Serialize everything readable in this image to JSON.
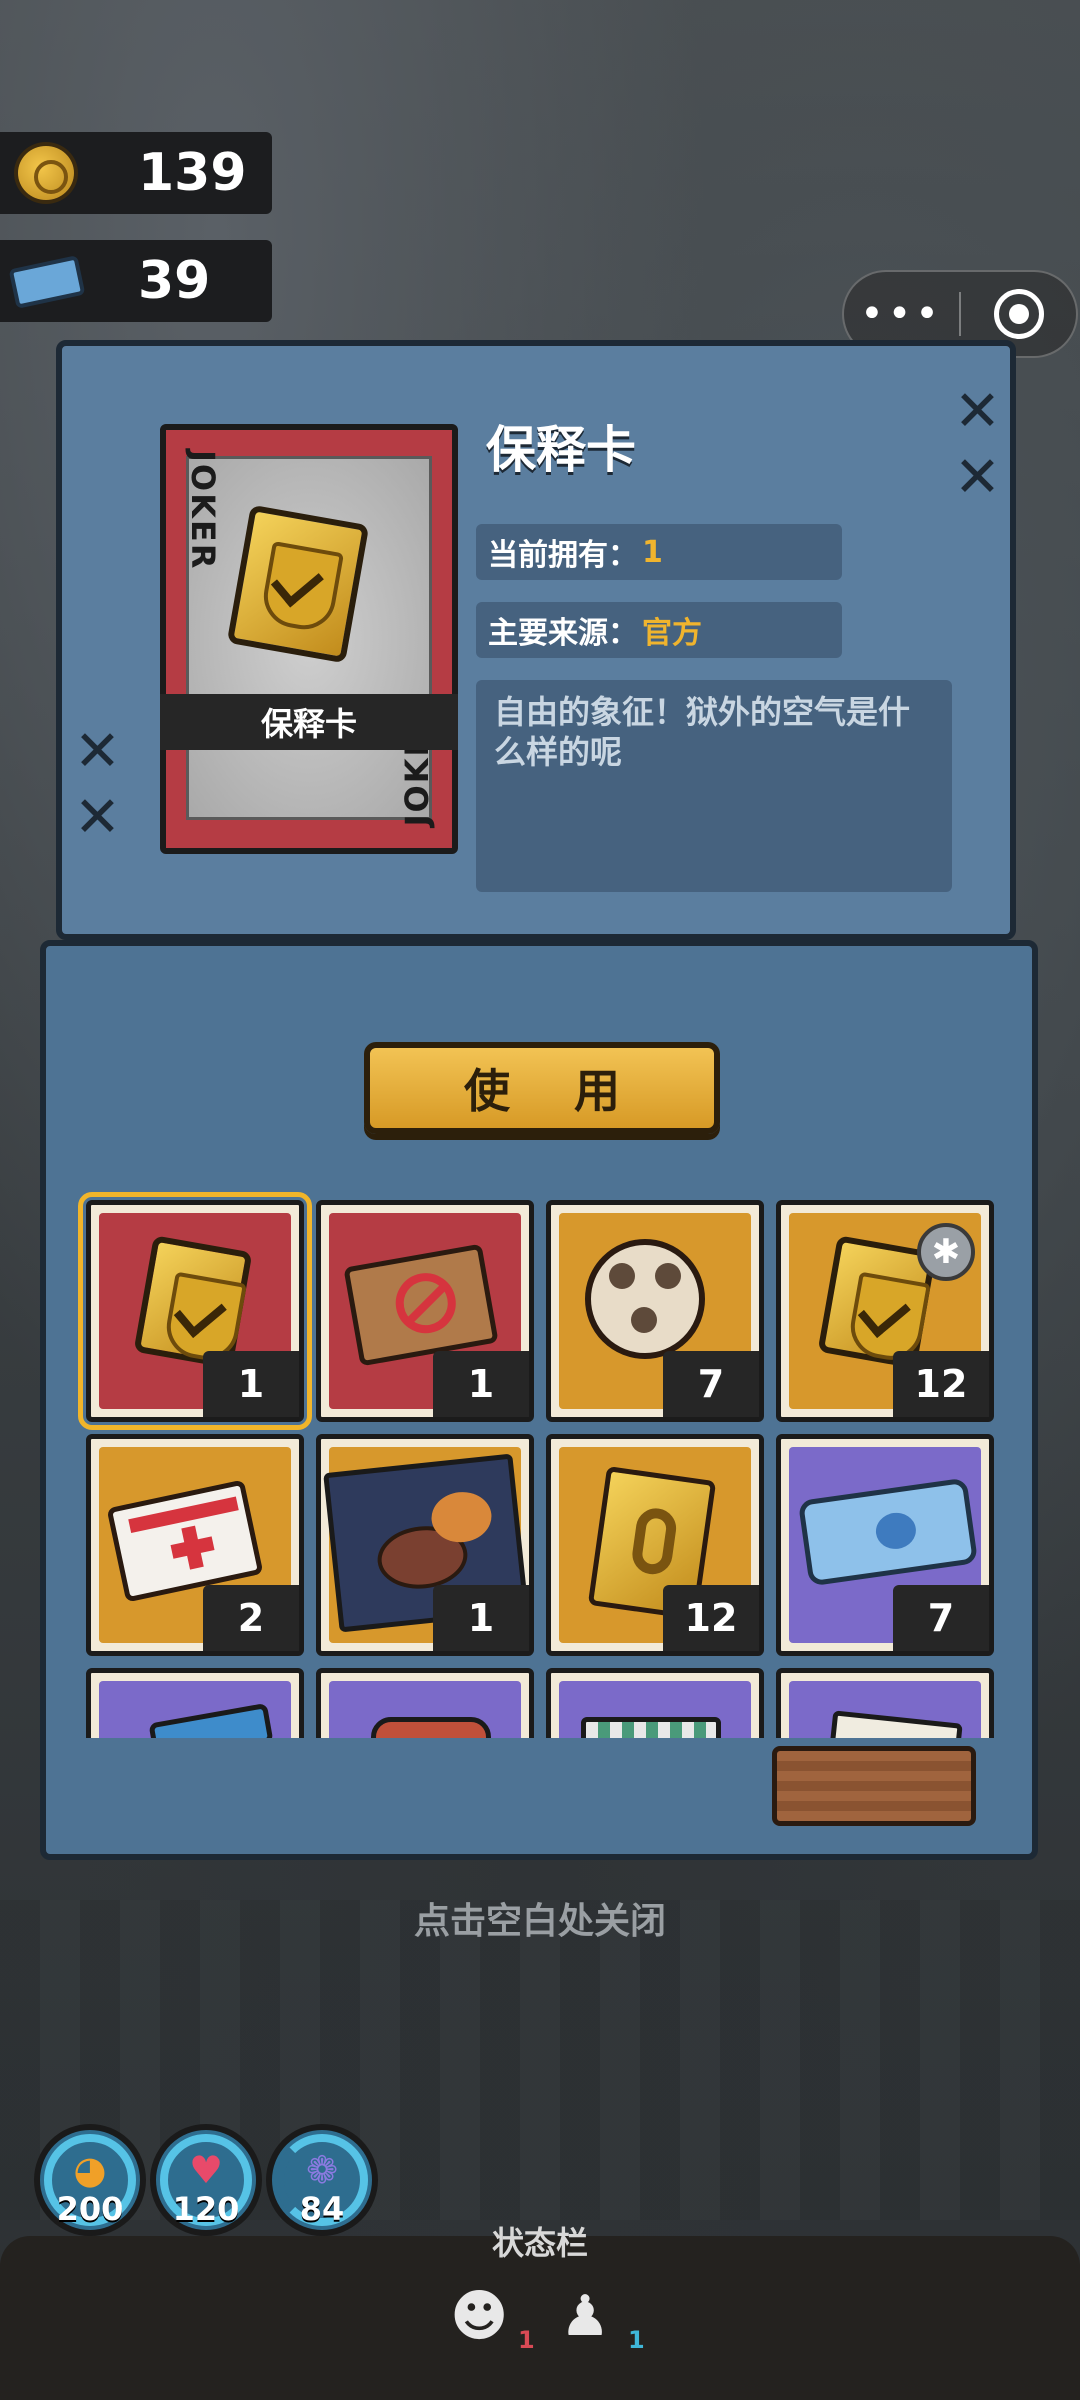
{
  "currencies": [
    {
      "icon": "coin-icon",
      "value": "139"
    },
    {
      "icon": "ticket-icon",
      "value": "39"
    }
  ],
  "capsule": {
    "more": "•••"
  },
  "item": {
    "name": "保释卡",
    "card_label": "保释卡",
    "card_corner_text": "JOKER",
    "owned_label": "当前拥有：",
    "owned_value": "1",
    "source_label": "主要来源：",
    "source_value": "官方",
    "description": "自由的象征！狱外的空气是什么样的呢"
  },
  "use_button": "使 用",
  "inventory": [
    {
      "name": "bail-card",
      "count": "1",
      "bg": "#b53c44",
      "selected": true
    },
    {
      "name": "forbidden-ticket",
      "count": "1",
      "bg": "#b53c44"
    },
    {
      "name": "film-reel",
      "count": "7",
      "bg": "#d7982c"
    },
    {
      "name": "bail-card-plus",
      "count": "12",
      "bg": "#d7982c",
      "badge": "star"
    },
    {
      "name": "medical-card",
      "count": "2",
      "bg": "#d7982c"
    },
    {
      "name": "steak-meal",
      "count": "1",
      "bg": "#d7982c"
    },
    {
      "name": "gold-ribbon-card",
      "count": "12",
      "bg": "#d7982c"
    },
    {
      "name": "blue-ticket",
      "count": "7",
      "bg": "#7b6ac9"
    },
    {
      "name": "item-9",
      "count": "",
      "bg": "#7b6ac9"
    },
    {
      "name": "item-10",
      "count": "",
      "bg": "#7b6ac9"
    },
    {
      "name": "item-11",
      "count": "",
      "bg": "#7b6ac9"
    },
    {
      "name": "item-12",
      "count": "",
      "bg": "#7b6ac9"
    }
  ],
  "close_hint": "点击空白处关闭",
  "stats": [
    {
      "icon": "hunger-icon",
      "value": "200"
    },
    {
      "icon": "heart-icon",
      "value": "120"
    },
    {
      "icon": "brain-icon",
      "value": "84"
    }
  ],
  "status_bar": {
    "title": "状态栏",
    "effects": [
      {
        "icon": "drama-mask-icon",
        "count": "1",
        "color": "#d84a55"
      },
      {
        "icon": "strength-icon",
        "count": "1",
        "color": "#3fb6d8"
      }
    ]
  }
}
